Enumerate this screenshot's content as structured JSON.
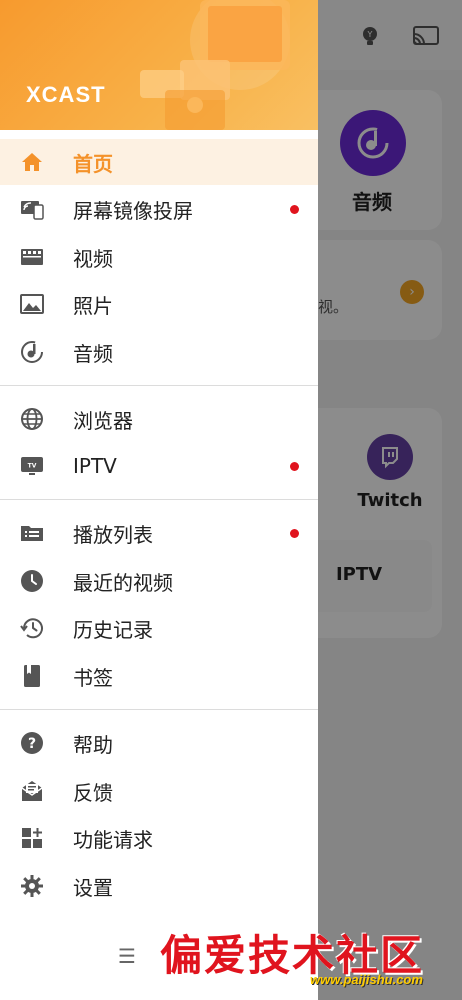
{
  "app": {
    "brand": "XCAST"
  },
  "background": {
    "audio_label": "音频",
    "tip_text": "视。",
    "twitch_label": "Twitch",
    "iptv_label": "IPTV"
  },
  "menu": {
    "groups": [
      [
        {
          "id": "home",
          "label": "首页",
          "icon": "home-icon",
          "active": true,
          "dot": false
        },
        {
          "id": "screen-mirror",
          "label": "屏幕镜像投屏",
          "icon": "screen-mirror-icon",
          "active": false,
          "dot": true
        },
        {
          "id": "video",
          "label": "视频",
          "icon": "clapperboard-icon",
          "active": false,
          "dot": false
        },
        {
          "id": "photo",
          "label": "照片",
          "icon": "image-icon",
          "active": false,
          "dot": false
        },
        {
          "id": "audio",
          "label": "音频",
          "icon": "music-note-icon",
          "active": false,
          "dot": false
        }
      ],
      [
        {
          "id": "browser",
          "label": "浏览器",
          "icon": "globe-icon",
          "active": false,
          "dot": false
        },
        {
          "id": "iptv",
          "label": "IPTV",
          "icon": "tv-icon",
          "active": false,
          "dot": true
        }
      ],
      [
        {
          "id": "playlist",
          "label": "播放列表",
          "icon": "playlist-folder-icon",
          "active": false,
          "dot": true
        },
        {
          "id": "recent",
          "label": "最近的视频",
          "icon": "clock-icon",
          "active": false,
          "dot": false
        },
        {
          "id": "history",
          "label": "历史记录",
          "icon": "history-icon",
          "active": false,
          "dot": false
        },
        {
          "id": "bookmarks",
          "label": "书签",
          "icon": "bookmark-icon",
          "active": false,
          "dot": false
        }
      ],
      [
        {
          "id": "help",
          "label": "帮助",
          "icon": "help-icon",
          "active": false,
          "dot": false
        },
        {
          "id": "feedback",
          "label": "反馈",
          "icon": "mail-icon",
          "active": false,
          "dot": false
        },
        {
          "id": "feature-request",
          "label": "功能请求",
          "icon": "add-widget-icon",
          "active": false,
          "dot": false
        },
        {
          "id": "settings",
          "label": "设置",
          "icon": "gear-icon",
          "active": false,
          "dot": false
        }
      ]
    ]
  },
  "watermark": {
    "text": "偏爱技术社区",
    "url": "www.paijishu.com"
  },
  "colors": {
    "accent": "#f4922a",
    "dot": "#e0141e",
    "icon": "#555555"
  }
}
